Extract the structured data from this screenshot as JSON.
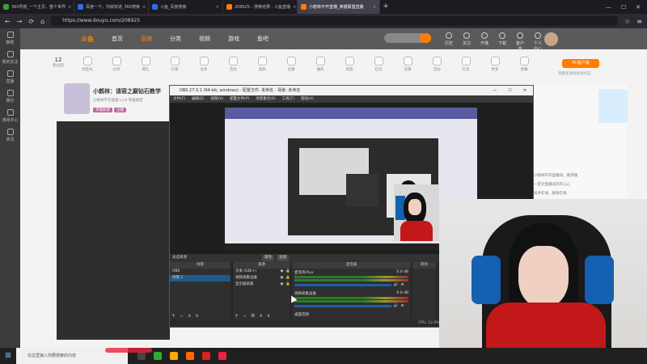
{
  "browser": {
    "tabs": [
      {
        "label": "360导航_一个主页，整个世界",
        "color": "#3c9f3c"
      },
      {
        "label": "百度一下，你就知道_360搜索",
        "color": "#2e6be6"
      },
      {
        "label": "斗鱼_百度搜索",
        "color": "#2e6be6"
      },
      {
        "label": "208925 - 搜索结果 - 斗鱼直播",
        "color": "#ff7d00"
      },
      {
        "label": "小鹤林不开直播_英雄联盟直播",
        "color": "#ff7d00",
        "active": true
      }
    ],
    "url": "https://www.douyu.com/208925",
    "back": "←",
    "forward": "→",
    "reload": "⟳",
    "home": "⌂"
  },
  "left_sidebar": [
    "推荐",
    "我的关注",
    "直播",
    "娱乐",
    "游戏中心",
    "资讯"
  ],
  "douyu": {
    "logo": "斗鱼",
    "nav": [
      "首页",
      "直播",
      "分类",
      "视频",
      "游戏",
      "鱼吧"
    ],
    "header_icons": [
      "历史",
      "关注",
      "开播",
      "下载",
      "客户端",
      "个人中心"
    ],
    "tools": [
      {
        "count": "12",
        "label": "粉丝团"
      },
      {
        "label": "领鱼丸"
      },
      {
        "label": "分享"
      },
      {
        "label": "赠礼"
      },
      {
        "label": "礼物"
      },
      {
        "label": "任务"
      },
      {
        "label": "活动"
      },
      {
        "label": "道具"
      },
      {
        "label": "主播"
      },
      {
        "label": "抽奖"
      },
      {
        "label": "贵族"
      },
      {
        "label": "红包"
      },
      {
        "label": "竞猜"
      },
      {
        "label": "活动"
      },
      {
        "label": "礼包"
      },
      {
        "label": "更多"
      },
      {
        "label": "弹幕"
      }
    ],
    "pc_button": "PC客户端",
    "tip": "观看高清视频请点击",
    "room_title": "小鹤林：请容之巅钻石教学",
    "room_sub": "小鹤林不开直播  Lv.8  英雄联盟",
    "tags": [
      "英雄联盟",
      "主播"
    ],
    "side_text": [
      "小鹤林不开直播间，要求播",
      "一定对直播间开开心心",
      "技术在线，颜值在线",
      "一起上分"
    ]
  },
  "obs": {
    "title": "OBS 27.0.1 (64-bit, windows) - 配置文件: 未命名 - 场景: 未命名",
    "window_controls": [
      "—",
      "☐",
      "✕"
    ],
    "menu": [
      "文件(F)",
      "编辑(E)",
      "视图(V)",
      "配置文件(P)",
      "场景集合(S)",
      "工具(T)",
      "帮助(H)"
    ],
    "source_bar_label": "未选择源",
    "props_label": "属性",
    "filter_label": "滤镜",
    "scenes_header": "场景",
    "scenes": [
      "OBS",
      "场景 2"
    ],
    "sources_header": "来源",
    "sources": [
      "文本 (GDI+)",
      "视频采集设备",
      "显示器采集"
    ],
    "mixer_header": "混音器",
    "mixer": [
      {
        "name": "麦克风/Aux",
        "db": "0.0 dB"
      },
      {
        "name": "视频采集设备",
        "db": "0.0 dB"
      }
    ],
    "mixer_extra": "桌面音频",
    "transitions_header": "转场",
    "status": "CPU: 12.0%  00:00:00  REC: 00:00:00"
  },
  "taskbar": {
    "search_placeholder": "在这里输入你要搜索的内容",
    "app_colors": [
      "#444",
      "#3a3",
      "#fa0",
      "#f60",
      "#d22",
      "#e24"
    ]
  }
}
